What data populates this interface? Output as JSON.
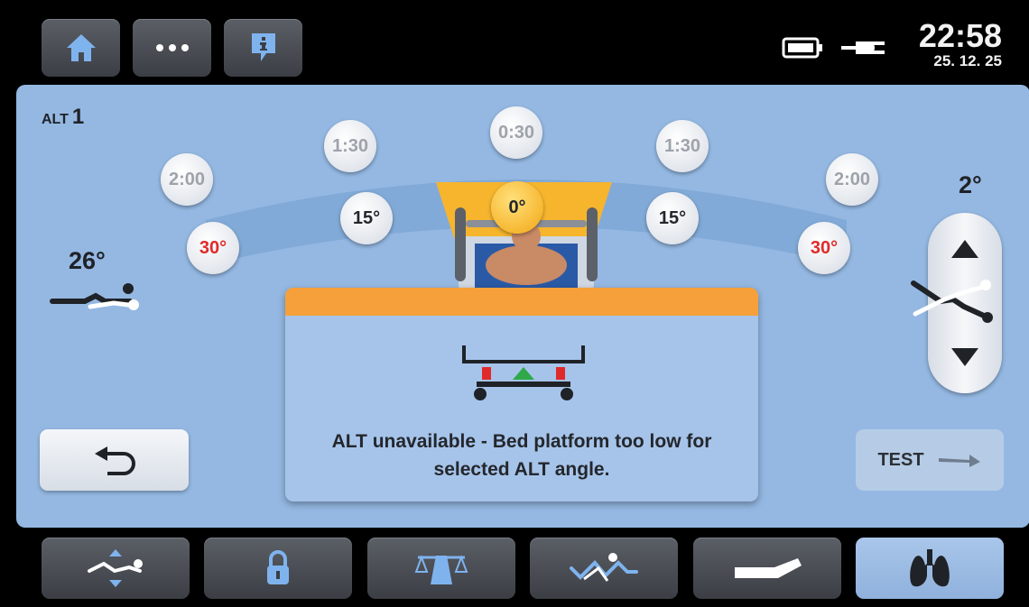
{
  "header": {
    "home_icon": "home-icon",
    "more_icon": "more-dots-icon",
    "info_icon": "info-icon",
    "battery_icon": "battery-icon",
    "plug_icon": "power-plug-icon",
    "time": "22:58",
    "date": "25. 12. 25"
  },
  "alt": {
    "label_small": "ALT",
    "label_number": "1",
    "left_angle": "26°",
    "right_angle": "2°",
    "times": {
      "left_far": "2:00",
      "left_mid": "1:30",
      "center": "0:30",
      "right_mid": "1:30",
      "right_far": "2:00"
    },
    "angles": {
      "left_30": "30°",
      "left_15": "15°",
      "center": "0°",
      "right_15": "15°",
      "right_30": "30°"
    },
    "test_label": "TEST"
  },
  "dialog": {
    "message": "ALT unavailable - Bed platform too low for selected ALT angle."
  },
  "bottom_nav": [
    {
      "name": "nav-bed-height",
      "icon": "bed-height-icon",
      "active": false
    },
    {
      "name": "nav-lock",
      "icon": "lock-icon",
      "active": false
    },
    {
      "name": "nav-scale",
      "icon": "scale-icon",
      "active": false
    },
    {
      "name": "nav-positions",
      "icon": "patient-position-icon",
      "active": false
    },
    {
      "name": "nav-mattress",
      "icon": "mattress-icon",
      "active": false
    },
    {
      "name": "nav-lungs",
      "icon": "lungs-icon",
      "active": true
    }
  ],
  "colors": {
    "accent": "#94b8e2",
    "warning": "#f5a03a",
    "alert_red": "#e02a2a"
  }
}
